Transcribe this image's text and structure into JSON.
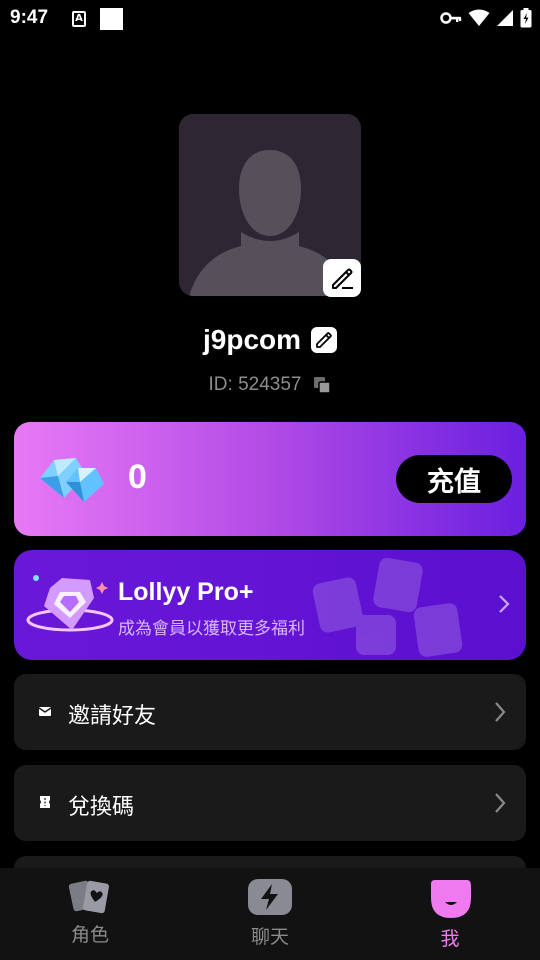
{
  "status_bar": {
    "time": "9:47",
    "a_badge": "A"
  },
  "profile": {
    "username": "j9pcom",
    "id_text": "ID: 524357"
  },
  "balance": {
    "value": "0",
    "recharge_label": "充值"
  },
  "pro": {
    "title": "Lollyy Pro+",
    "subtitle": "成為會員以獲取更多福利"
  },
  "menu": {
    "items": [
      {
        "label": "邀請好友",
        "icon": "envelope-icon"
      },
      {
        "label": "兌換碼",
        "icon": "ticket-icon"
      }
    ]
  },
  "nav": {
    "items": [
      {
        "label": "角色",
        "icon": "cards-icon"
      },
      {
        "label": "聊天",
        "icon": "bolt-chat-icon"
      },
      {
        "label": "我",
        "icon": "smile-face-icon",
        "active": true
      }
    ]
  },
  "colors": {
    "accent_pink": "#f07bf0",
    "balance_gradient_start": "#e87af5",
    "balance_gradient_end": "#6a1fe0",
    "pro_bg": "#5b0fcf"
  }
}
